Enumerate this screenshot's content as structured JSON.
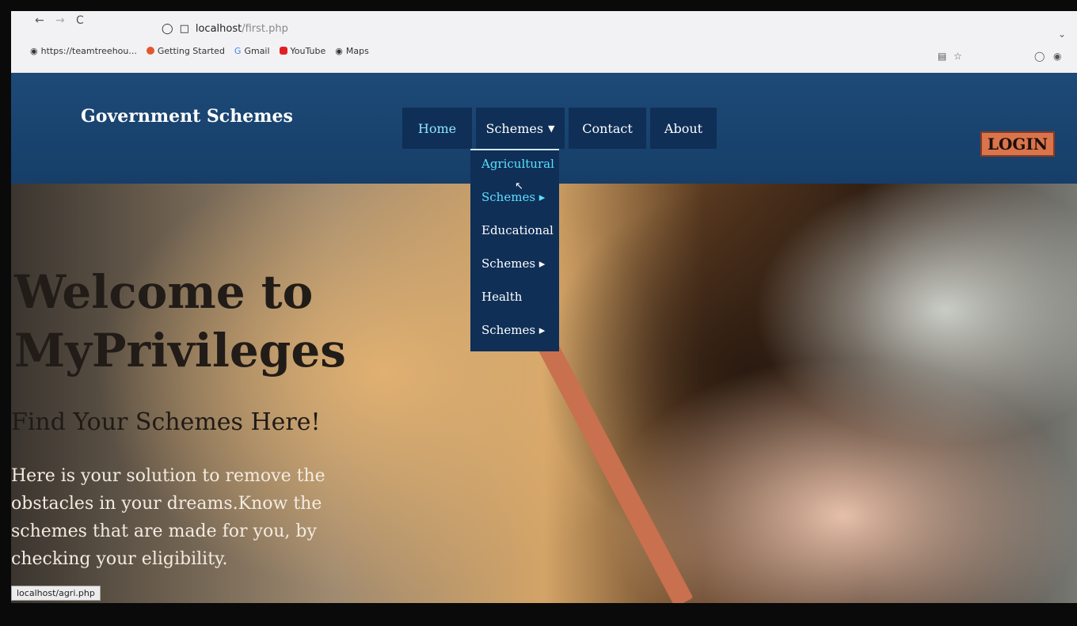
{
  "browser": {
    "nav_back": "←",
    "nav_forward": "→",
    "nav_reload": "C",
    "url_host": "localhost",
    "url_path": "/first.php",
    "bookmarks": [
      {
        "label": "https://teamtreehou..."
      },
      {
        "label": "Getting Started"
      },
      {
        "label": "Gmail"
      },
      {
        "label": "YouTube"
      },
      {
        "label": "Maps"
      }
    ],
    "status_url": "localhost/agri.php"
  },
  "navbar": {
    "brand": "Government Schemes",
    "items": [
      {
        "label": "Home"
      },
      {
        "label": "Schemes"
      },
      {
        "label": "Contact"
      },
      {
        "label": "About"
      }
    ],
    "login_label": "LOGIN"
  },
  "dropdown": {
    "items": [
      {
        "line1": "Agricultural",
        "line2": "Schemes"
      },
      {
        "line1": "Educational",
        "line2": "Schemes"
      },
      {
        "line1": "Health",
        "line2": "Schemes"
      }
    ]
  },
  "hero": {
    "title_line1": "Welcome to",
    "title_line2": "MyPrivileges",
    "subtitle": "Find Your Schemes Here!",
    "description": "Here is your solution to remove the obstacles in your dreams.Know the schemes that are made for you, by checking your eligibility."
  },
  "colors": {
    "navbar": "#1d4a78",
    "nav_item": "#0f2f57",
    "active_link": "#5be0ff",
    "login_bg": "#d9744c"
  }
}
